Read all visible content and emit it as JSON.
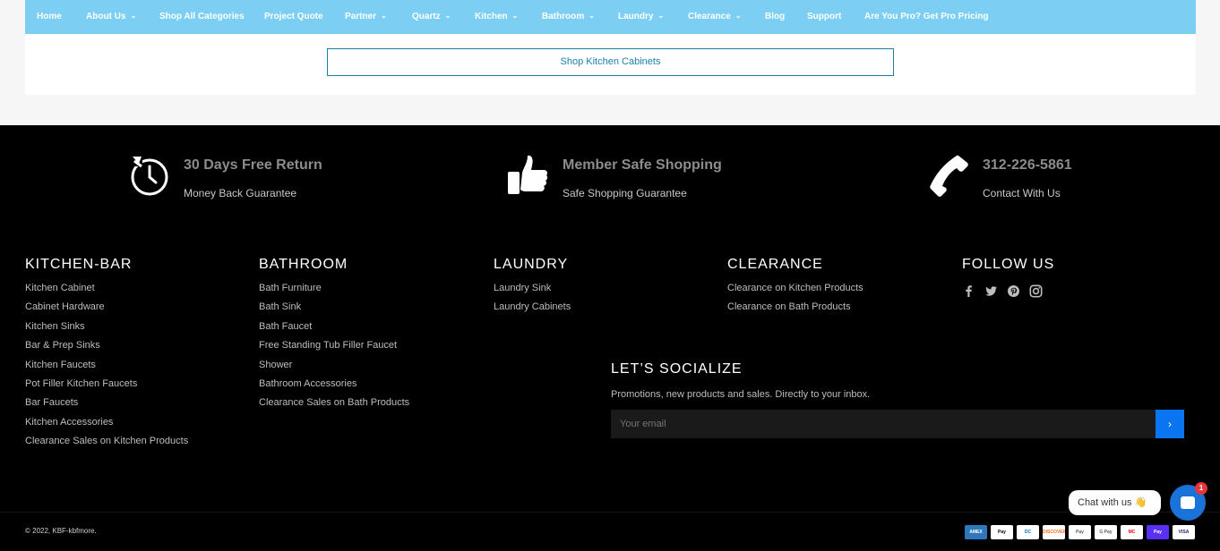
{
  "nav": {
    "items": [
      {
        "label": "Home",
        "dropdown": false
      },
      {
        "label": "About Us",
        "dropdown": true
      },
      {
        "label": "Shop All Categories",
        "dropdown": false
      },
      {
        "label": "Project Quote",
        "dropdown": false
      },
      {
        "label": "Partner",
        "dropdown": true
      },
      {
        "label": "Quartz",
        "dropdown": true
      },
      {
        "label": "Kitchen",
        "dropdown": true
      },
      {
        "label": "Bathroom",
        "dropdown": true
      },
      {
        "label": "Laundry",
        "dropdown": true
      },
      {
        "label": "Clearance",
        "dropdown": true
      },
      {
        "label": "Blog",
        "dropdown": false
      },
      {
        "label": "Support",
        "dropdown": false
      },
      {
        "label": "Are You Pro? Get Pro Pricing",
        "dropdown": false
      }
    ],
    "chevron": "⌄"
  },
  "cta": {
    "shop_kitchen_label": "Shop Kitchen Cabinets"
  },
  "features": [
    {
      "title": "30 Days Free Return",
      "subtitle": "Money Back Guarantee",
      "icon": "return-clock-icon"
    },
    {
      "title": "Member Safe Shopping",
      "subtitle": "Safe Shopping Guarantee",
      "icon": "thumbs-up-icon"
    },
    {
      "title": "312-226-5861",
      "subtitle": "Contact With Us",
      "icon": "phone-icon"
    }
  ],
  "columns": [
    {
      "heading": "KITCHEN-BAR",
      "links": [
        "Kitchen Cabinet",
        "Cabinet Hardware",
        "Kitchen Sinks",
        "Bar & Prep Sinks",
        "Kitchen Faucets",
        "Pot Filler Kitchen Faucets",
        "Bar Faucets",
        "Kitchen Accessories",
        "Clearance Sales on Kitchen Products"
      ]
    },
    {
      "heading": "BATHROOM",
      "links": [
        "Bath Furniture",
        "Bath Sink",
        "Bath Faucet",
        "Free Standing Tub Filler Faucet",
        "Shower",
        "Bathroom Accessories",
        "Clearance Sales on Bath Products"
      ]
    },
    {
      "heading": "LAUNDRY",
      "links": [
        "Laundry Sink",
        "Laundry Cabinets"
      ]
    },
    {
      "heading": "CLEARANCE",
      "links": [
        "Clearance on Kitchen Products",
        "Clearance on Bath Products"
      ]
    },
    {
      "heading": "FOLLOW US",
      "links": []
    }
  ],
  "social": [
    "facebook-icon",
    "twitter-icon",
    "pinterest-icon",
    "instagram-icon"
  ],
  "newsletter": {
    "heading": "LET’S SOCIALIZE",
    "description": "Promotions, new products and sales. Directly to your inbox.",
    "placeholder": "Your email",
    "submit_glyph": "›"
  },
  "footer": {
    "copyright": "© 2022, KBF-kbfmore."
  },
  "payments": [
    {
      "label": "AMEX",
      "bg": "#2e77bb",
      "fg": "#ffffff"
    },
    {
      "label": "Pay",
      "bg": "#ffffff",
      "fg": "#000000"
    },
    {
      "label": "DC",
      "bg": "#ffffff",
      "fg": "#0079be"
    },
    {
      "label": "DISCOVER",
      "bg": "#ffffff",
      "fg": "#f76f20"
    },
    {
      "label": "Pay",
      "bg": "#ffffff",
      "fg": "#5f6368"
    },
    {
      "label": "G Pay",
      "bg": "#ffffff",
      "fg": "#5f6368"
    },
    {
      "label": "MC",
      "bg": "#ffffff",
      "fg": "#eb001b"
    },
    {
      "label": "Pay",
      "bg": "#5a31f4",
      "fg": "#ffffff"
    },
    {
      "label": "VISA",
      "bg": "#ffffff",
      "fg": "#1a1f71"
    }
  ],
  "chat": {
    "label": "Chat with us 👋",
    "badge": "1"
  },
  "colors": {
    "nav_bg": "#7ccff3",
    "accent": "#1e7fa8",
    "submit": "#0b74f0"
  }
}
